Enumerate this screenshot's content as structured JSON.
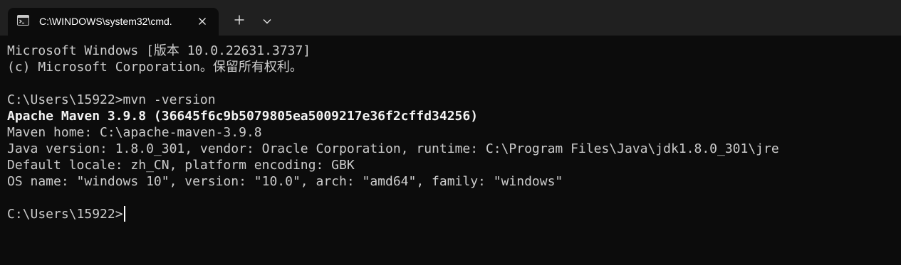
{
  "tab": {
    "title": "C:\\WINDOWS\\system32\\cmd.",
    "icon": "cmd-icon"
  },
  "tabbar": {
    "new_tab_icon": "plus-icon",
    "dropdown_icon": "chevron-down-icon",
    "close_icon": "close-icon"
  },
  "colors": {
    "terminal_bg": "#0c0c0c",
    "tabbar_bg": "#202020",
    "text": "#cccccc",
    "text_bright": "#f2f2f2"
  },
  "terminal": {
    "lines": [
      "Microsoft Windows [版本 10.0.22631.3737]",
      "(c) Microsoft Corporation。保留所有权利。",
      "",
      "C:\\Users\\15922>mvn -version",
      "Apache Maven 3.9.8 (36645f6c9b5079805ea5009217e36f2cffd34256)",
      "Maven home: C:\\apache-maven-3.9.8",
      "Java version: 1.8.0_301, vendor: Oracle Corporation, runtime: C:\\Program Files\\Java\\jdk1.8.0_301\\jre",
      "Default locale: zh_CN, platform encoding: GBK",
      "OS name: \"windows 10\", version: \"10.0\", arch: \"amd64\", family: \"windows\"",
      ""
    ],
    "prompt": "C:\\Users\\15922>"
  }
}
